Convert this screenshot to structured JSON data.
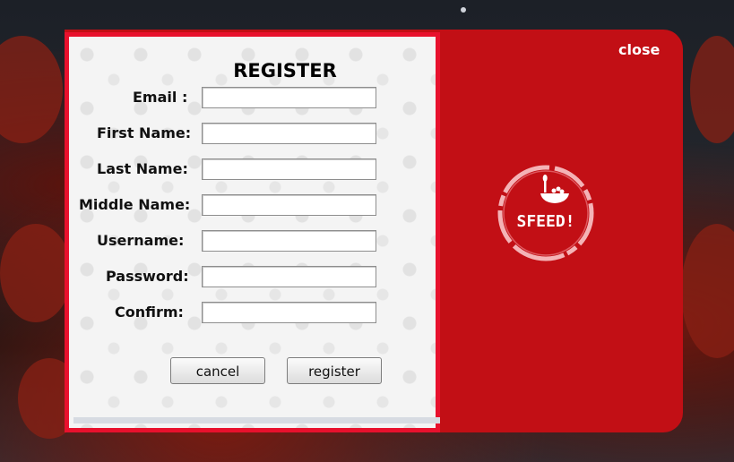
{
  "register_form": {
    "title": "REGISTER",
    "fields": [
      {
        "label": "Email :",
        "value": ""
      },
      {
        "label": "First Name:",
        "value": ""
      },
      {
        "label": "Last Name:",
        "value": ""
      },
      {
        "label": "Middle Name:",
        "value": ""
      },
      {
        "label": "Username:",
        "value": ""
      },
      {
        "label": "Password:",
        "value": ""
      },
      {
        "label": "Confirm:",
        "value": ""
      }
    ],
    "cancel_label": "cancel",
    "register_label": "register"
  },
  "side_panel": {
    "close_label": "close",
    "logo_text": "SFEED!"
  },
  "colors": {
    "accent_red": "#c20f15",
    "border_red": "#e8112d"
  },
  "icons": [
    "bowl-spoon-icon",
    "food-pattern-icon"
  ]
}
